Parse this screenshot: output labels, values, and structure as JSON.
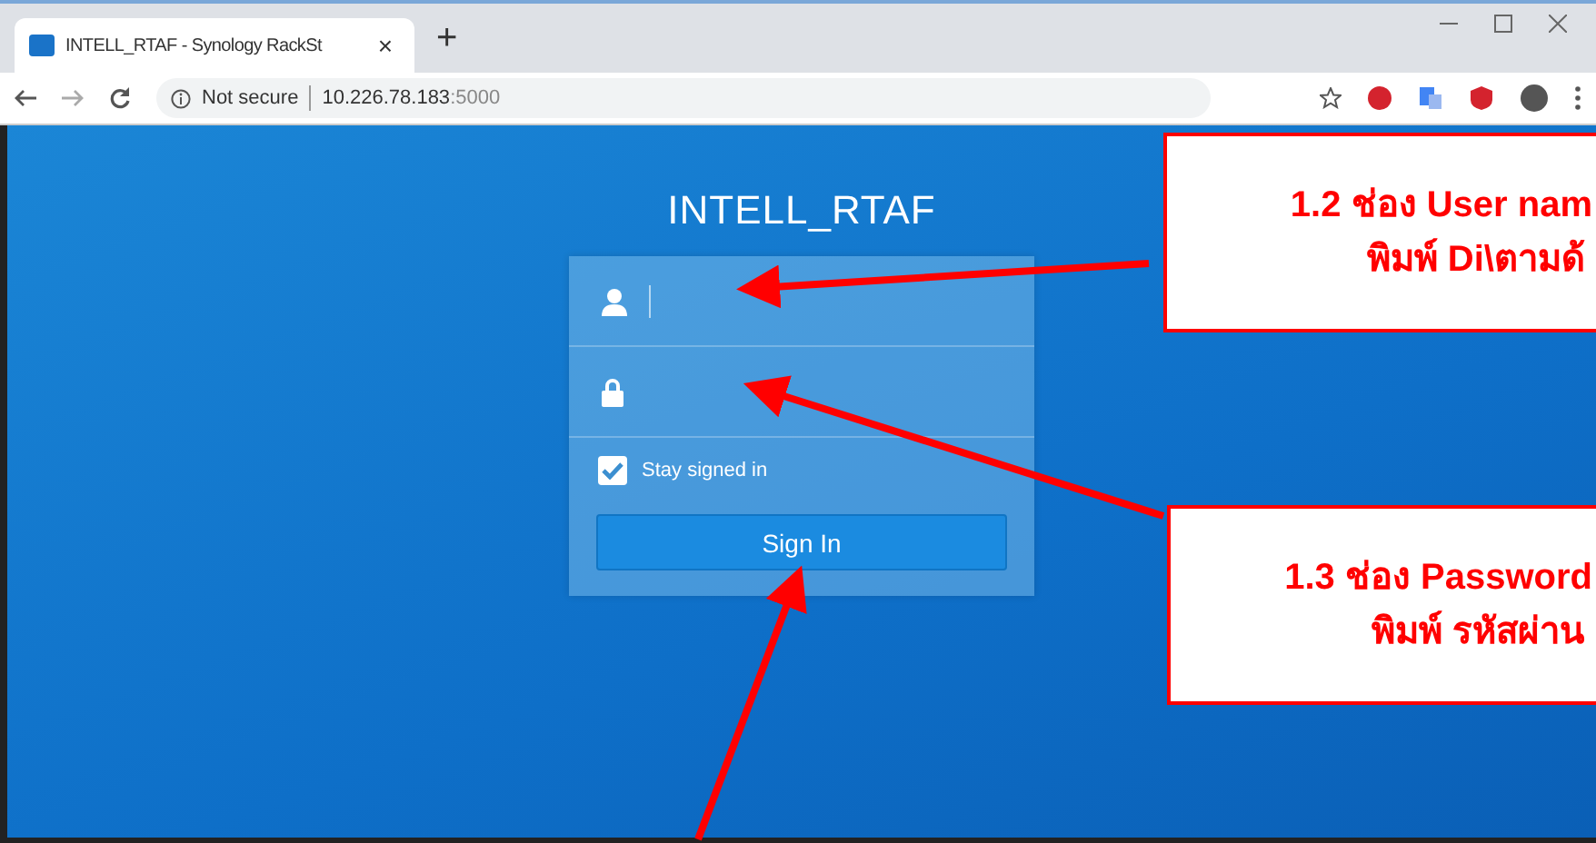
{
  "browser": {
    "tab": {
      "title": "INTELL_RTAF - Synology RackSt",
      "close": "×"
    },
    "new_tab": "+",
    "address": {
      "security": "Not secure",
      "host": "10.226.78.183",
      "port": ":5000"
    }
  },
  "login": {
    "title": "INTELL_RTAF",
    "stay_signed_in": {
      "label": "Stay signed in",
      "checked": true
    },
    "button": "Sign In"
  },
  "callouts": [
    {
      "lines": [
        "1.2 ช่อง User nam",
        "พิมพ์ Di\\ตามด้"
      ]
    },
    {
      "lines": [
        "1.3 ช่อง Password",
        "พิมพ์ รหัสผ่าน"
      ]
    }
  ]
}
